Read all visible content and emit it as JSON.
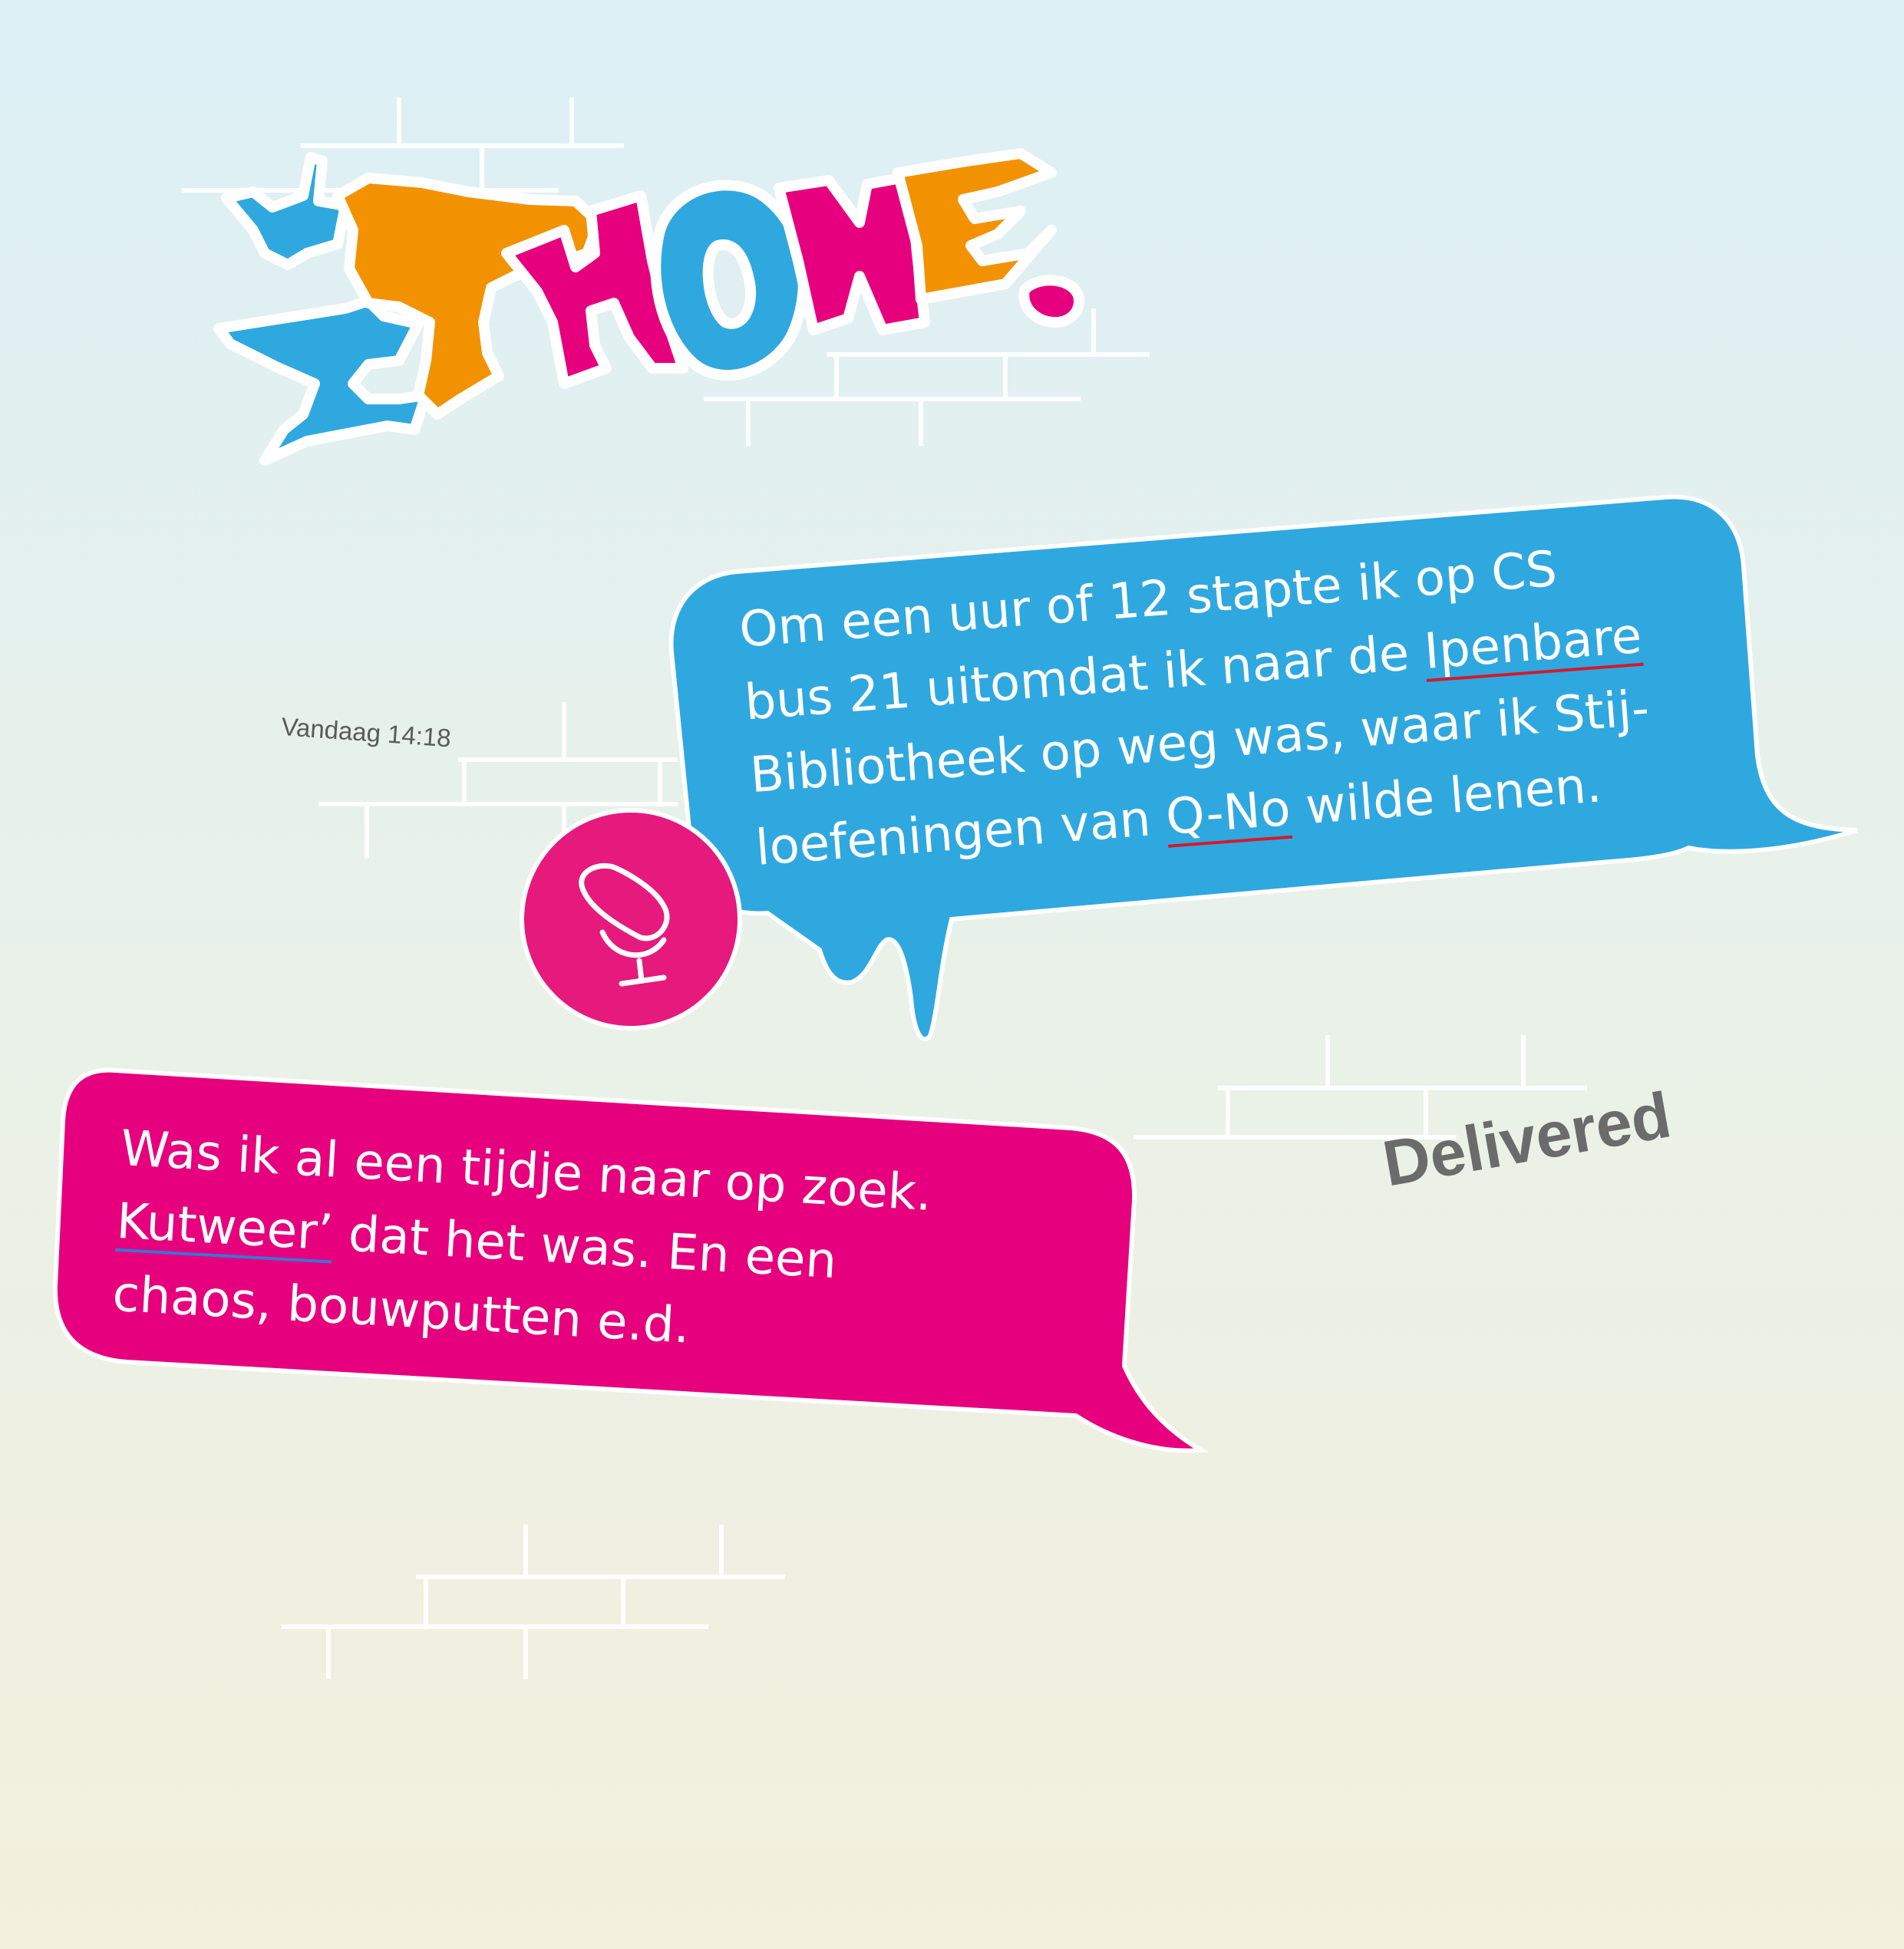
{
  "logo": {
    "text": "iPHONE.",
    "colors": {
      "blue": "#2fa8e0",
      "orange": "#f39200",
      "magenta": "#e6007e"
    }
  },
  "timestamp": "Vandaag 14:18",
  "message_in": {
    "lines": [
      [
        "Om een uur of 12 stapte ik op CS"
      ],
      [
        "bus 21 uitomdat ik naar de ",
        "Ipenbare"
      ],
      [
        "Bibliotheek op weg was, waar ik Stij-"
      ],
      [
        "loefeningen van ",
        "Q-No",
        " wilde lenen."
      ]
    ],
    "color": "#2fa8e0"
  },
  "message_out": {
    "lines": [
      [
        "Was ik al een tijdje naar op zoek."
      ],
      [
        "Kutweer’",
        " dat het was. En een"
      ],
      [
        "chaos, bouwputten e.d."
      ]
    ],
    "color": "#e6007e"
  },
  "mic_button": {
    "icon": "microphone-icon",
    "color": "#e6197d"
  },
  "status": "Delivered",
  "colors": {
    "brick_lines": "#ffffff",
    "text_gray": "#6b6b6b"
  }
}
